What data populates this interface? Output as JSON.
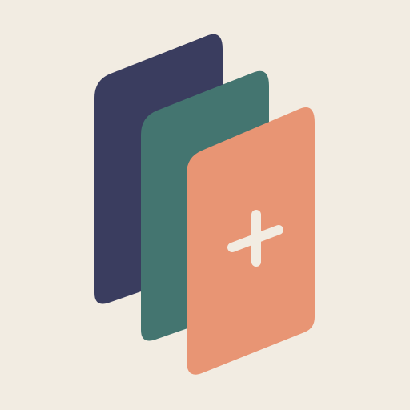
{
  "icon": {
    "name": "stacked-cards-add-icon",
    "colors": {
      "background": "#F2ECE2",
      "card_back": "#3A3D5F",
      "card_middle": "#447570",
      "card_front": "#E89574",
      "plus": "#F2ECE2"
    }
  }
}
